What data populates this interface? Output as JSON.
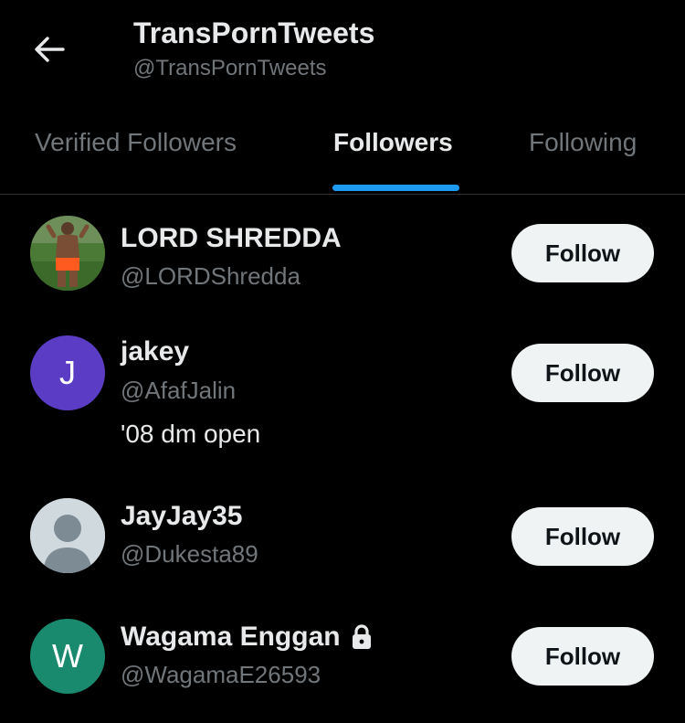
{
  "header": {
    "title": "TransPornTweets",
    "handle": "@TransPornTweets",
    "back_icon": "arrow-left-icon"
  },
  "tabs": [
    {
      "label": "Verified Followers",
      "active": false
    },
    {
      "label": "Followers",
      "active": true
    },
    {
      "label": "Following",
      "active": false
    }
  ],
  "colors": {
    "background": "#000000",
    "accent": "#1d9bf0",
    "secondary_text": "#71767b",
    "primary_text": "#e7e9ea",
    "button_bg": "#eff3f4"
  },
  "followers": [
    {
      "name": "LORD SHREDDA",
      "handle": "@LORDShredda",
      "bio": "",
      "avatar": "photo",
      "button": "Follow",
      "locked": false
    },
    {
      "name": "jakey",
      "handle": "@AfafJalin",
      "bio": "'08 dm open",
      "avatar_letter": "J",
      "avatar_color": "#5b3cc4",
      "button": "Follow",
      "locked": false
    },
    {
      "name": "JayJay35",
      "handle": "@Dukesta89",
      "bio": "",
      "avatar": "default-profile",
      "button": "Follow",
      "locked": false
    },
    {
      "name": "Wagama Enggan",
      "handle": "@WagamaE26593",
      "bio": "",
      "avatar_letter": "W",
      "avatar_color": "#1a8a6e",
      "button": "Follow",
      "locked": true
    }
  ]
}
